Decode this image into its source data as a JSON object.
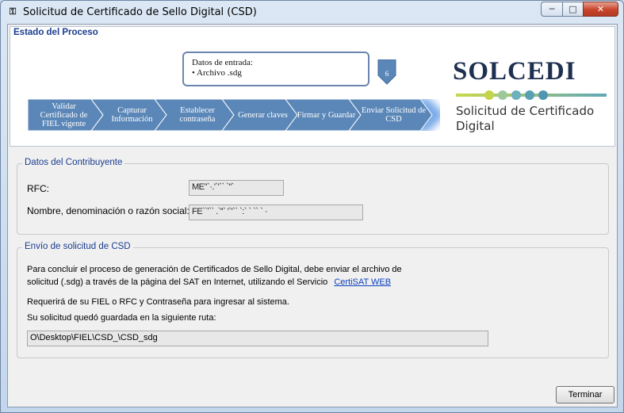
{
  "window": {
    "title": "Solicitud de Certificado de Sello Digital (CSD)",
    "icon": "app-icon",
    "buttons": {
      "minimize": "─",
      "maximize": "□",
      "close": "✕"
    }
  },
  "process": {
    "heading": "Estado del Proceso",
    "callout_title": "Datos de entrada:",
    "callout_item": "• Archivo .sdg",
    "current_step_number": "6",
    "steps": [
      {
        "label": "Validar Certificado de FIEL vigente",
        "state": "done"
      },
      {
        "label": "Capturar Información",
        "state": "done"
      },
      {
        "label": "Establecer contraseña",
        "state": "done"
      },
      {
        "label": "Generar claves",
        "state": "done"
      },
      {
        "label": "Firmar y Guardar",
        "state": "done"
      },
      {
        "label": "Enviar Solicitud de CSD",
        "state": "current"
      }
    ],
    "colors": {
      "step_fill": "#5b87b8",
      "step_current_glow": "#4d8ee0"
    }
  },
  "logo": {
    "name": "SOLCEDI",
    "subtitle": "Solicitud de Certificado Digital",
    "dot_colors": [
      "#c5d54a",
      "#9fc89a",
      "#6cb1bd",
      "#5aa0b5",
      "#5096b0"
    ]
  },
  "contribuyente": {
    "legend": "Datos del Contribuyente",
    "rfc_label": "RFC:",
    "rfc_value": "MEʻ'`·.'`'`` `\"`",
    "name_label": "Nombre, denominación o razón social:",
    "name_value": "FE``ʼ`` .`''` '`'`` `:` ` `` ` ·"
  },
  "envio": {
    "legend": "Envío de solicitud de CSD",
    "para1_line1": "Para concluir el proceso de generación de Certificados de Sello Digital, debe enviar el archivo de",
    "para1_line2": "solicitud (.sdg) a través de la página del SAT en Internet, utilizando el Servicio",
    "link": "CertiSAT WEB",
    "para2": "Requerirá de su FIEL o RFC y Contraseña para ingresar al sistema.",
    "para3": "Su solicitud quedó guardada en la siguiente ruta:",
    "path": "O\\Desktop\\FIEL\\CSD_\\CSD_sdg"
  },
  "footer": {
    "finish_button": "Terminar"
  }
}
